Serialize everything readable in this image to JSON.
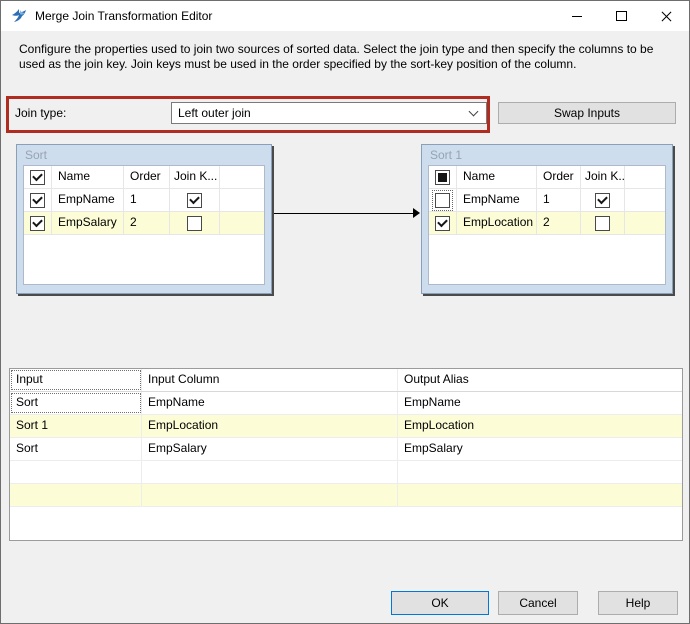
{
  "window": {
    "title": "Merge Join Transformation Editor"
  },
  "description": "Configure the properties used to join two sources of sorted data. Select the join type and then specify the columns to be used as the join key. Join keys must be used in the order specified by the sort-key position of the column.",
  "join_type": {
    "label": "Join type:",
    "value": "Left outer join"
  },
  "swap_inputs_label": "Swap Inputs",
  "panels": {
    "left": {
      "title": "Sort",
      "select_all": "checked",
      "headers": {
        "name": "Name",
        "order": "Order",
        "join_key": "Join K..."
      },
      "rows": [
        {
          "name": "EmpName",
          "order": "1",
          "selected": "checked",
          "join_key": "checked"
        },
        {
          "name": "EmpSalary",
          "order": "2",
          "selected": "checked",
          "join_key": "unchecked"
        }
      ]
    },
    "right": {
      "title": "Sort 1",
      "select_all": "indeterminate",
      "headers": {
        "name": "Name",
        "order": "Order",
        "join_key": "Join K..."
      },
      "rows": [
        {
          "name": "EmpName",
          "order": "1",
          "selected": "focused",
          "join_key": "checked"
        },
        {
          "name": "EmpLocation",
          "order": "2",
          "selected": "checked",
          "join_key": "unchecked"
        }
      ]
    }
  },
  "mapping": {
    "headers": {
      "input": "Input",
      "input_column": "Input Column",
      "output_alias": "Output Alias"
    },
    "rows": [
      {
        "input": "Sort",
        "input_column": "EmpName",
        "output_alias": "EmpName"
      },
      {
        "input": "Sort 1",
        "input_column": "EmpLocation",
        "output_alias": "EmpLocation"
      },
      {
        "input": "Sort",
        "input_column": "EmpSalary",
        "output_alias": "EmpSalary"
      }
    ]
  },
  "footer": {
    "ok": "OK",
    "cancel": "Cancel",
    "help": "Help"
  },
  "colors": {
    "annotation_red": "#b02b20",
    "row_highlight": "#fcfcd7",
    "panel_blue": "#cdddee",
    "default_button_border": "#0078d7"
  }
}
